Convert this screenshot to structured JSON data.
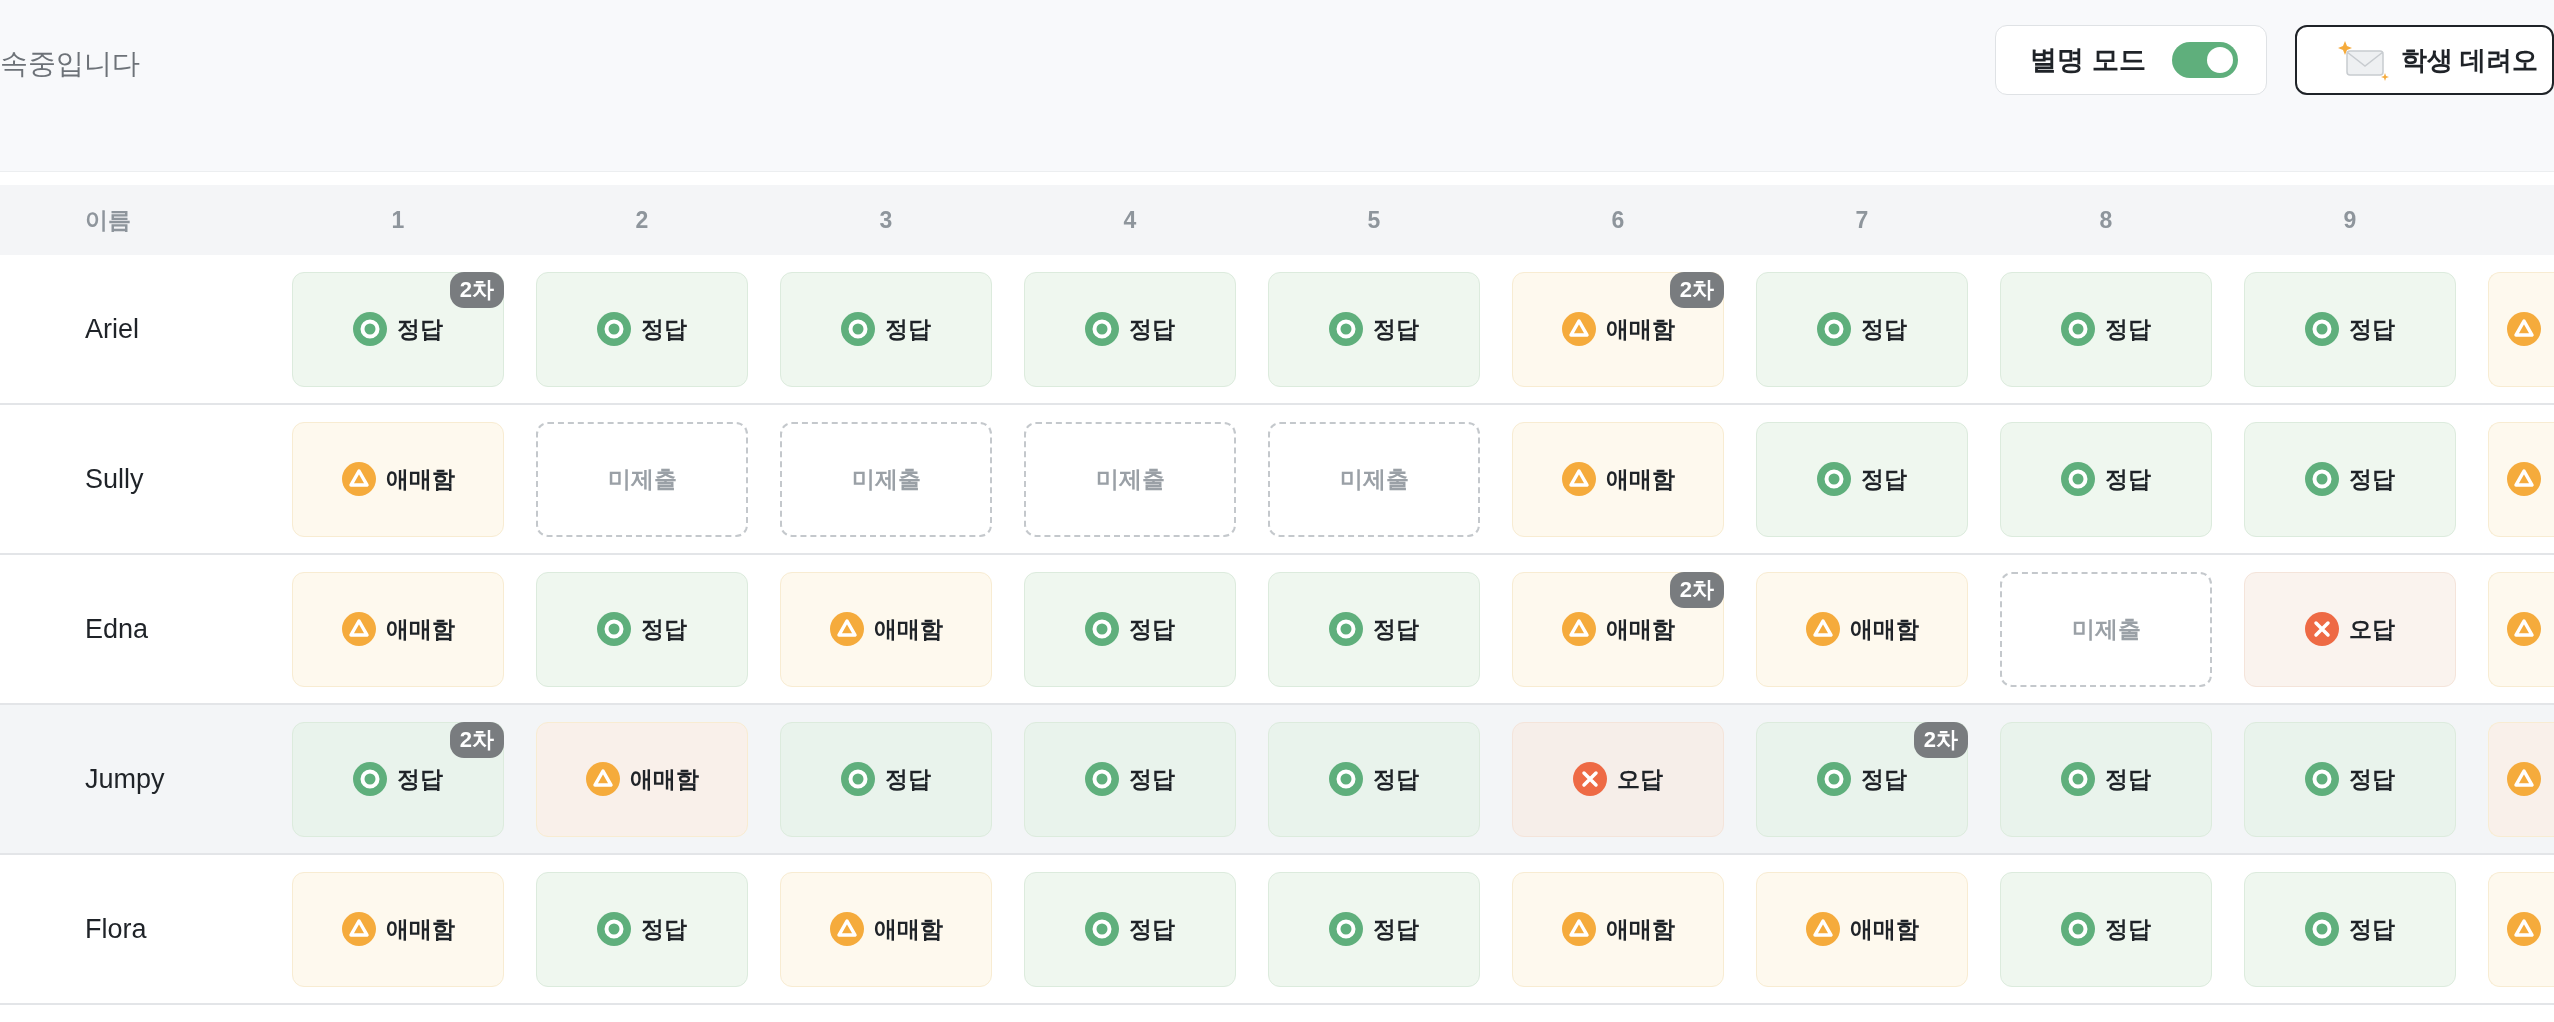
{
  "header": {
    "status_text": "속중입니다",
    "alias_mode": {
      "label": "별명 모드",
      "on": true
    },
    "bring_button": {
      "label": "학생 데려오"
    }
  },
  "table": {
    "columns": [
      "이름",
      "1",
      "2",
      "3",
      "4",
      "5",
      "6",
      "7",
      "8",
      "9"
    ],
    "rows": [
      {
        "highlighted": false,
        "cells": [
          {
            "kind": "name",
            "text": "Ariel"
          },
          {
            "kind": "correct",
            "label": "정답",
            "badge": "2차"
          },
          {
            "kind": "correct",
            "label": "정답"
          },
          {
            "kind": "correct",
            "label": "정답"
          },
          {
            "kind": "correct",
            "label": "정답"
          },
          {
            "kind": "correct",
            "label": "정답"
          },
          {
            "kind": "unclear",
            "label": "애매함",
            "badge": "2차"
          },
          {
            "kind": "correct",
            "label": "정답"
          },
          {
            "kind": "correct",
            "label": "정답"
          },
          {
            "kind": "correct",
            "label": "정답"
          },
          {
            "kind": "unclear"
          }
        ]
      },
      {
        "highlighted": false,
        "cells": [
          {
            "kind": "name",
            "text": "Sully"
          },
          {
            "kind": "unclear",
            "label": "애매함"
          },
          {
            "kind": "missing",
            "label": "미제출"
          },
          {
            "kind": "missing",
            "label": "미제출"
          },
          {
            "kind": "missing",
            "label": "미제출"
          },
          {
            "kind": "missing",
            "label": "미제출"
          },
          {
            "kind": "unclear",
            "label": "애매함"
          },
          {
            "kind": "correct",
            "label": "정답"
          },
          {
            "kind": "correct",
            "label": "정답"
          },
          {
            "kind": "correct",
            "label": "정답"
          },
          {
            "kind": "unclear"
          }
        ]
      },
      {
        "highlighted": false,
        "cells": [
          {
            "kind": "name",
            "text": "Edna"
          },
          {
            "kind": "unclear",
            "label": "애매함"
          },
          {
            "kind": "correct",
            "label": "정답"
          },
          {
            "kind": "unclear",
            "label": "애매함"
          },
          {
            "kind": "correct",
            "label": "정답"
          },
          {
            "kind": "correct",
            "label": "정답"
          },
          {
            "kind": "unclear",
            "label": "애매함",
            "badge": "2차"
          },
          {
            "kind": "unclear",
            "label": "애매함"
          },
          {
            "kind": "missing",
            "label": "미제출"
          },
          {
            "kind": "wrong",
            "label": "오답"
          },
          {
            "kind": "unclear"
          }
        ]
      },
      {
        "highlighted": true,
        "cells": [
          {
            "kind": "name",
            "text": "Jumpy"
          },
          {
            "kind": "correct",
            "label": "정답",
            "badge": "2차"
          },
          {
            "kind": "unclear",
            "label": "애매함"
          },
          {
            "kind": "correct",
            "label": "정답"
          },
          {
            "kind": "correct",
            "label": "정답"
          },
          {
            "kind": "correct",
            "label": "정답"
          },
          {
            "kind": "wrong",
            "label": "오답"
          },
          {
            "kind": "correct",
            "label": "정답",
            "badge": "2차"
          },
          {
            "kind": "correct",
            "label": "정답"
          },
          {
            "kind": "correct",
            "label": "정답"
          },
          {
            "kind": "unclear"
          }
        ]
      },
      {
        "highlighted": false,
        "cells": [
          {
            "kind": "name",
            "text": "Flora"
          },
          {
            "kind": "unclear",
            "label": "애매함"
          },
          {
            "kind": "correct",
            "label": "정답"
          },
          {
            "kind": "unclear",
            "label": "애매함"
          },
          {
            "kind": "correct",
            "label": "정답"
          },
          {
            "kind": "correct",
            "label": "정답"
          },
          {
            "kind": "unclear",
            "label": "애매함"
          },
          {
            "kind": "unclear",
            "label": "애매함"
          },
          {
            "kind": "correct",
            "label": "정답"
          },
          {
            "kind": "correct",
            "label": "정답"
          },
          {
            "kind": "unclear"
          }
        ]
      }
    ]
  }
}
